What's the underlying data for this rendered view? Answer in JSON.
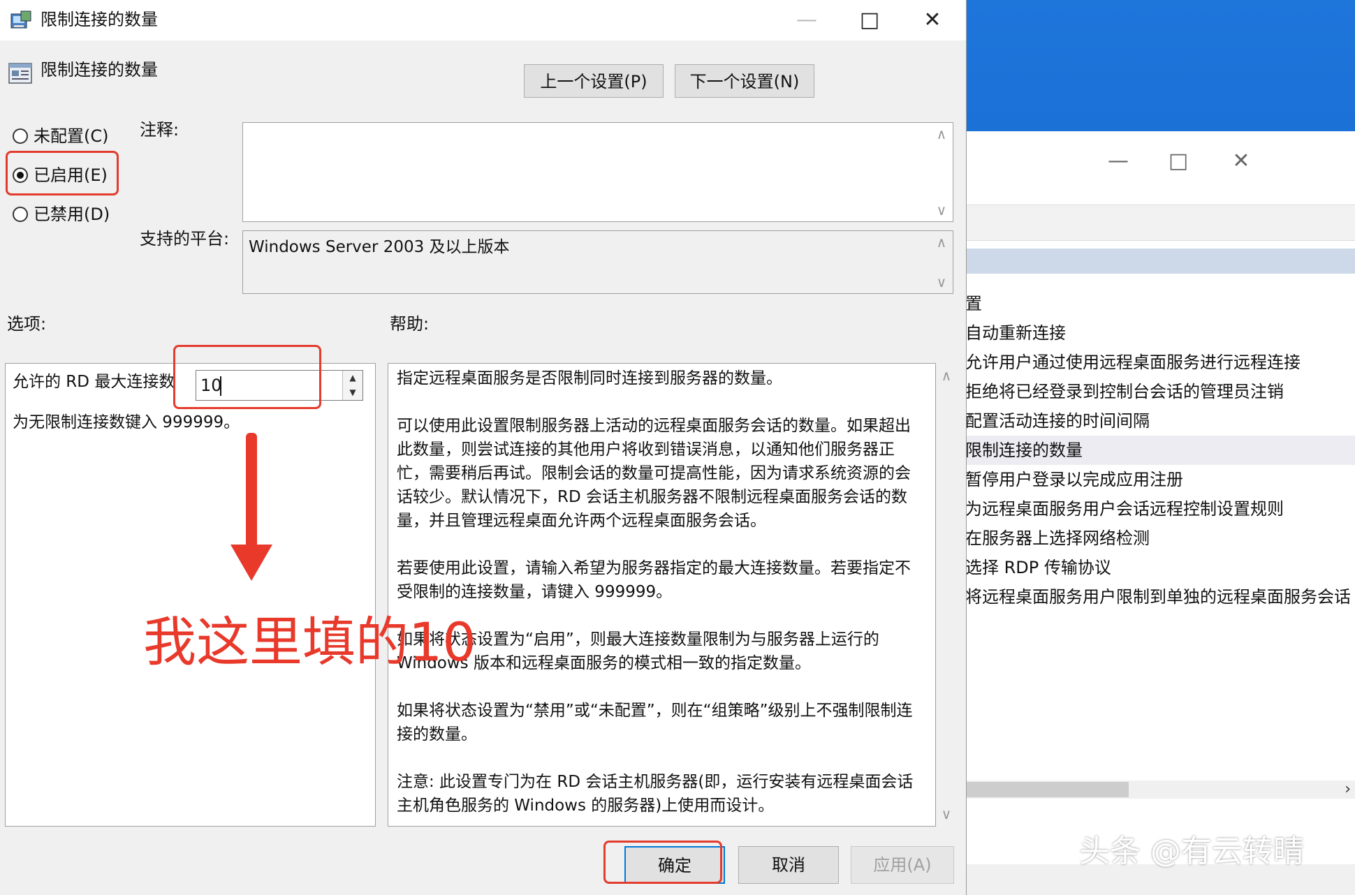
{
  "dialog": {
    "title": "限制连接的数量",
    "header_title": "限制连接的数量",
    "prev_button": "上一个设置(P)",
    "next_button": "下一个设置(N)",
    "radios": {
      "not_configured": "未配置(C)",
      "enabled": "已启用(E)",
      "disabled": "已禁用(D)",
      "selected": "enabled"
    },
    "comment_label": "注释:",
    "comment_value": "",
    "platform_label": "支持的平台:",
    "platform_value": "Windows Server 2003 及以上版本",
    "options_label": "选项:",
    "help_label": "帮助:",
    "option_field_label": "允许的 RD 最大连接数",
    "option_field_value": "10",
    "option_hint": "为无限制连接数键入 999999。",
    "help_paragraphs": [
      "指定远程桌面服务是否限制同时连接到服务器的数量。",
      "可以使用此设置限制服务器上活动的远程桌面服务会话的数量。如果超出此数量，则尝试连接的其他用户将收到错误消息，以通知他们服务器正忙，需要稍后再试。限制会话的数量可提高性能，因为请求系统资源的会话较少。默认情况下，RD 会话主机服务器不限制远程桌面服务会话的数量，并且管理远程桌面允许两个远程桌面服务会话。",
      "若要使用此设置，请输入希望为服务器指定的最大连接数量。若要指定不受限制的连接数量，请键入 999999。",
      "如果将状态设置为“启用”，则最大连接数量限制为与服务器上运行的 Windows 版本和远程桌面服务的模式相一致的指定数量。",
      "如果将状态设置为“禁用”或“未配置”，则在“组策略”级别上不强制限制连接的数量。",
      "注意: 此设置专门为在 RD 会话主机服务器(即，运行安装有远程桌面会话主机角色服务的 Windows 的服务器)上使用而设计。"
    ],
    "ok_button": "确定",
    "cancel_button": "取消",
    "apply_button": "应用(A)"
  },
  "background_window": {
    "items": [
      "置",
      "自动重新连接",
      "允许用户通过使用远程桌面服务进行远程连接",
      "拒绝将已经登录到控制台会话的管理员注销",
      "配置活动连接的时间间隔",
      "限制连接的数量",
      "暂停用户登录以完成应用注册",
      "为远程桌面服务用户会话远程控制设置规则",
      "在服务器上选择网络检测",
      "选择 RDP 传输协议",
      "将远程桌面服务用户限制到单独的远程桌面服务会话"
    ],
    "selected_index": 5
  },
  "annotation": {
    "text": "我这里填的10",
    "color": "#e8392b"
  },
  "watermark": "头条 @有云转晴",
  "icons": [
    "policy-icon",
    "minimize-icon",
    "maximize-icon",
    "close-icon",
    "arrow-down-annotation"
  ]
}
